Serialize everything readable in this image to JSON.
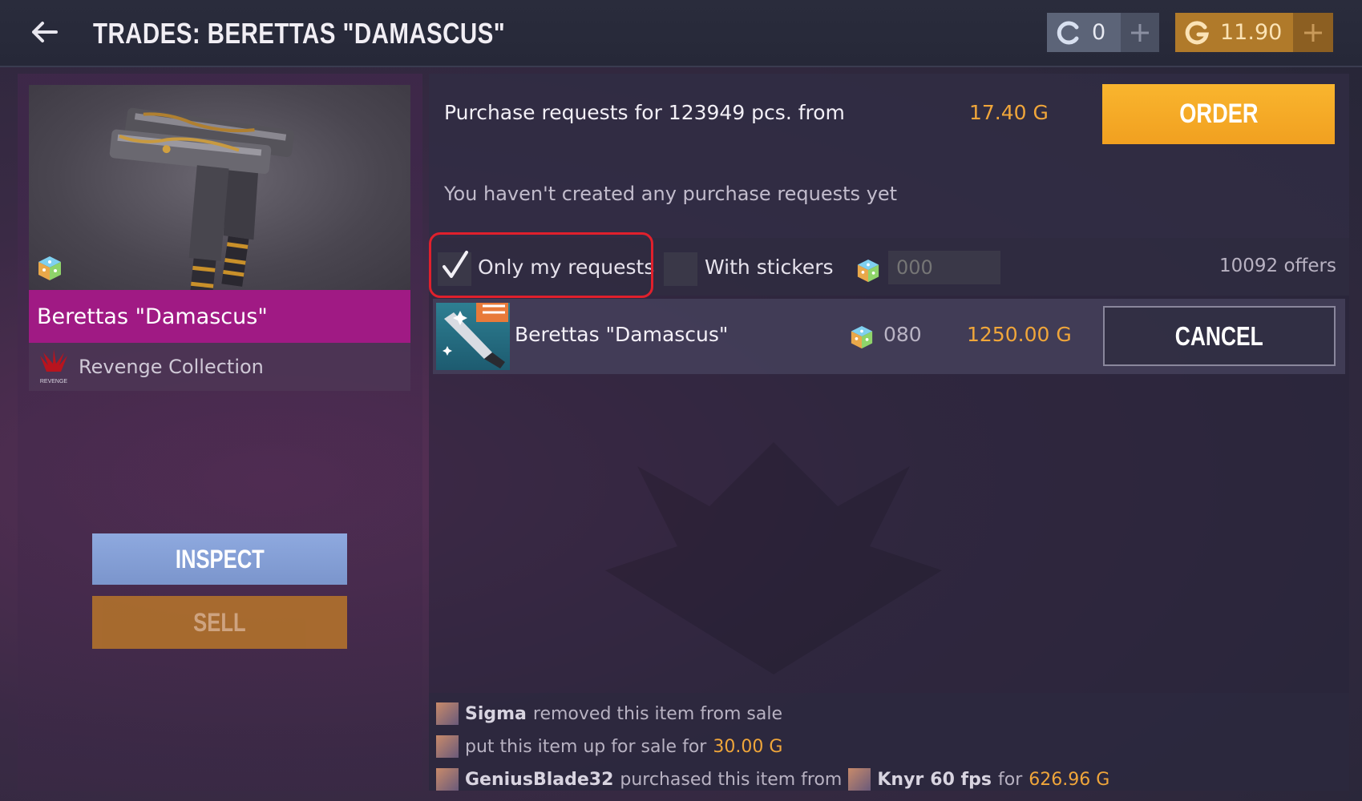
{
  "header": {
    "title": "TRADES: BERETTAS \"DAMASCUS\"",
    "silver_balance": "0",
    "gold_balance": "11.90"
  },
  "item": {
    "name": "Berettas \"Damascus\"",
    "collection": "Revenge Collection",
    "collection_logo_text": "REVENGE",
    "inspect_label": "INSPECT",
    "sell_label": "SELL"
  },
  "requests": {
    "summary": "Purchase requests for 123949 pcs. from",
    "min_price": "17.40 G",
    "order_label": "ORDER",
    "empty_message": "You haven't created any purchase requests yet"
  },
  "filters": {
    "only_mine_label": "Only my requests",
    "only_mine_checked": true,
    "with_stickers_label": "With stickers",
    "with_stickers_checked": false,
    "pattern_placeholder": "000",
    "offers_count": "10092 offers"
  },
  "offers": [
    {
      "name": "Berettas \"Damascus\"",
      "pattern": "080",
      "price": "1250.00 G",
      "action_label": "CANCEL"
    }
  ],
  "history": [
    {
      "user": "Sigma",
      "action": "removed this item from sale",
      "price": ""
    },
    {
      "user": "",
      "action": "put this item up for sale for",
      "price": "30.00 G"
    },
    {
      "user": "GeniusBlade32",
      "action": "purchased this item from",
      "seller": "Knyr",
      "seller_suffix": "60 fps",
      "for": "for",
      "price": "626.96 G"
    }
  ],
  "colors": {
    "accent_gold": "#f0a63a",
    "order_button": "#f9b52e",
    "rarity_magenta": "#a01a84",
    "inspect_blue": "#8ea9df",
    "highlight_red": "#e0202c"
  },
  "icons": {
    "back": "arrow-left-icon",
    "silver_currency": "silver-coin-icon",
    "gold_currency": "gold-coin-icon",
    "add": "plus-icon",
    "rarity": "dice-icon",
    "checkmark": "checkmark-icon"
  }
}
